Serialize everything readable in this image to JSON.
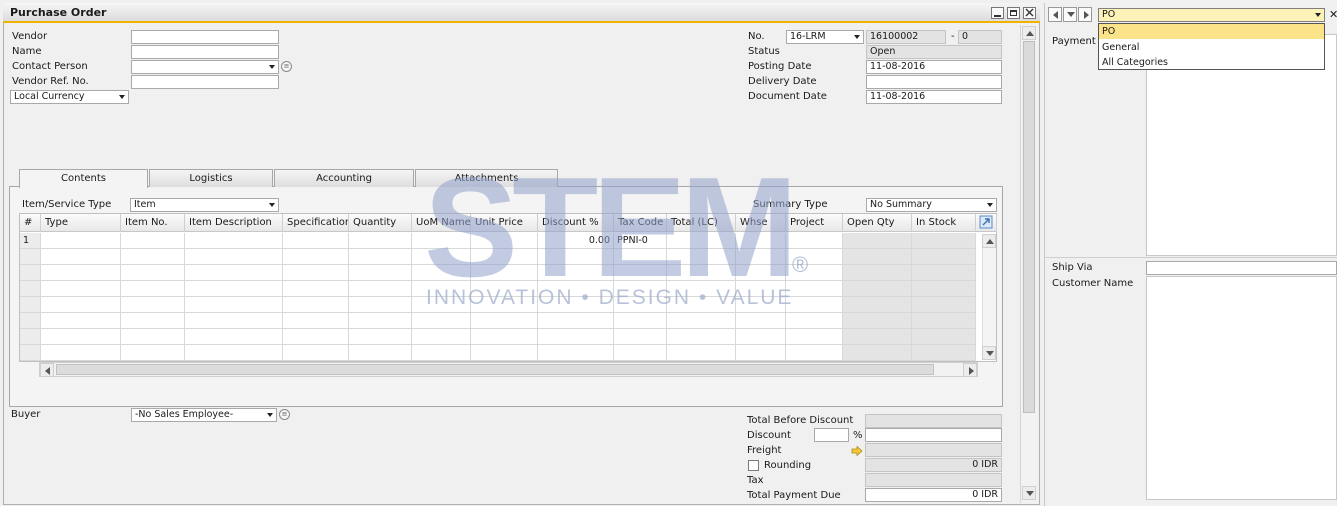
{
  "window": {
    "title": "Purchase Order"
  },
  "header_left": {
    "vendor_label": "Vendor",
    "name_label": "Name",
    "contact_person_label": "Contact Person",
    "vendor_ref_label": "Vendor Ref. No.",
    "currency": "Local Currency"
  },
  "header_right": {
    "no_label": "No.",
    "series": "16-LRM",
    "doc_number": "16100002",
    "dash": "-",
    "doc_suffix": "0",
    "status_label": "Status",
    "status_value": "Open",
    "posting_date_label": "Posting Date",
    "posting_date_value": "11-08-2016",
    "delivery_date_label": "Delivery Date",
    "document_date_label": "Document Date",
    "document_date_value": "11-08-2016"
  },
  "tabs": [
    "Contents",
    "Logistics",
    "Accounting",
    "Attachments"
  ],
  "contents": {
    "item_service_type_label": "Item/Service Type",
    "item_service_type_value": "Item",
    "summary_type_label": "Summary Type",
    "summary_type_value": "No Summary"
  },
  "grid": {
    "columns": [
      "#",
      "Type",
      "Item No.",
      "Item Description",
      "Specification",
      "Quantity",
      "UoM Name",
      "Unit Price",
      "Discount %",
      "Tax Code",
      "Total (LC)",
      "Whse",
      "Project",
      "Open Qty",
      "In Stock"
    ],
    "row1": {
      "num": "1",
      "discount": "0.00",
      "tax_code": "PPNI-0"
    }
  },
  "footer_left": {
    "buyer_label": "Buyer",
    "buyer_value": "-No Sales Employee-"
  },
  "totals": {
    "total_before_discount_label": "Total Before Discount",
    "discount_label": "Discount",
    "percent_sign": "%",
    "freight_label": "Freight",
    "rounding_label": "Rounding",
    "rounding_value": "0 IDR",
    "tax_label": "Tax",
    "total_payment_due_label": "Total Payment Due",
    "total_payment_due_value": "0 IDR"
  },
  "right_panel": {
    "category_selected": "PO",
    "category_options": [
      "PO",
      "General",
      "All Categories"
    ],
    "payment_label": "Payment",
    "ship_via_label": "Ship Via",
    "customer_name_label": "Customer Name"
  },
  "watermark": {
    "logo_text": "STEM",
    "registered": "®",
    "tagline": "INNOVATION • DESIGN • VALUE"
  },
  "colors": {
    "title_accent": "#f0b400",
    "selected_option": "#fbe38a",
    "watermark": "#8fa0c8"
  },
  "icons": [
    "minimize-icon",
    "restore-icon",
    "close-icon",
    "info-icon",
    "expand-arrow-icon",
    "arrow-right-icon"
  ]
}
